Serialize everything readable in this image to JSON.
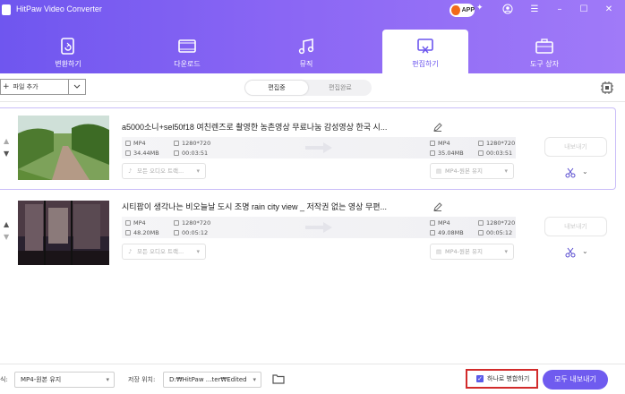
{
  "window": {
    "title": "HitPaw Video Converter",
    "app_badge": "APP"
  },
  "nav": {
    "tabs": [
      {
        "label": "변환하기",
        "icon": "convert-icon",
        "active": false
      },
      {
        "label": "다운로드",
        "icon": "download-icon",
        "active": false
      },
      {
        "label": "뮤직",
        "icon": "music-icon",
        "active": false
      },
      {
        "label": "편집하기",
        "icon": "edit-video-icon",
        "active": true
      },
      {
        "label": "도구 상자",
        "icon": "toolbox-icon",
        "active": false
      }
    ]
  },
  "toolbar": {
    "add_file_label": "파일 추가",
    "segment": {
      "editing": "편집중",
      "done": "편집완료"
    }
  },
  "files": [
    {
      "title": "a5000소니+sel50f18 여친렌즈로 촬영한 농촌영상 무료나눔 감성영상 한국 시...",
      "source": {
        "format": "MP4",
        "resolution": "1280*720",
        "size": "34.44MB",
        "duration": "00:03:51"
      },
      "target": {
        "format": "MP4",
        "resolution": "1280*720",
        "size": "35.04MB",
        "duration": "00:03:51"
      },
      "audio_select": "모든 오디오 트랙...",
      "format_select": "MP4-원본 유지",
      "convert_label": "내보내기"
    },
    {
      "title": "시티팝이 생각나는 비오늘날 도시 조명 rain city view _ 저작권 없는 영상 무편...",
      "source": {
        "format": "MP4",
        "resolution": "1280*720",
        "size": "48.20MB",
        "duration": "00:05:12"
      },
      "target": {
        "format": "MP4",
        "resolution": "1280*720",
        "size": "49.08MB",
        "duration": "00:05:12"
      },
      "audio_select": "모든 오디오 트랙...",
      "format_select": "MP4-원본 유지",
      "convert_label": "내보내기"
    }
  ],
  "bottom": {
    "format_label": "식:",
    "format_value": "MP4-원본 유지",
    "save_label": "저장 위치:",
    "save_path": "D:₩HitPaw ...ter₩Edited",
    "merge_label": "하나로 병합하기",
    "merge_checked": true,
    "export_all": "모두 내보내기"
  },
  "colors": {
    "accent": "#6f5bef",
    "highlight": "#d22b2b"
  }
}
